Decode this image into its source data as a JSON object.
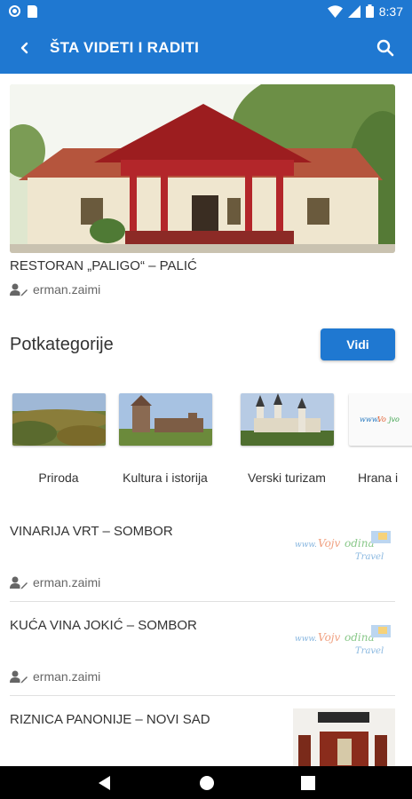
{
  "status_bar": {
    "time": "8:37"
  },
  "app_bar": {
    "title": "ŠTA VIDETI I RADITI"
  },
  "featured": {
    "title": "RESTORAN „PALIGO“ – PALIĆ",
    "author": "erman.zaimi"
  },
  "subcategories": {
    "title": "Potkategorije",
    "button_label": "Vidi",
    "items": [
      {
        "label": "Priroda"
      },
      {
        "label": "Kultura i istorija"
      },
      {
        "label": "Verski turizam"
      },
      {
        "label": "Hrana i"
      }
    ]
  },
  "list": [
    {
      "title": "VINARIJA VRT – SOMBOR",
      "author": "erman.zaimi"
    },
    {
      "title": "KUĆA VINA JOKIĆ – SOMBOR",
      "author": "erman.zaimi"
    },
    {
      "title": "RIZNICA PANONIJE – NOVI SAD",
      "author": ""
    }
  ],
  "colors": {
    "primary": "#1f78d1",
    "nav_bar": "#000000"
  },
  "icons": {
    "back": "back-arrow-icon",
    "search": "search-icon",
    "author": "user-edit-icon"
  }
}
